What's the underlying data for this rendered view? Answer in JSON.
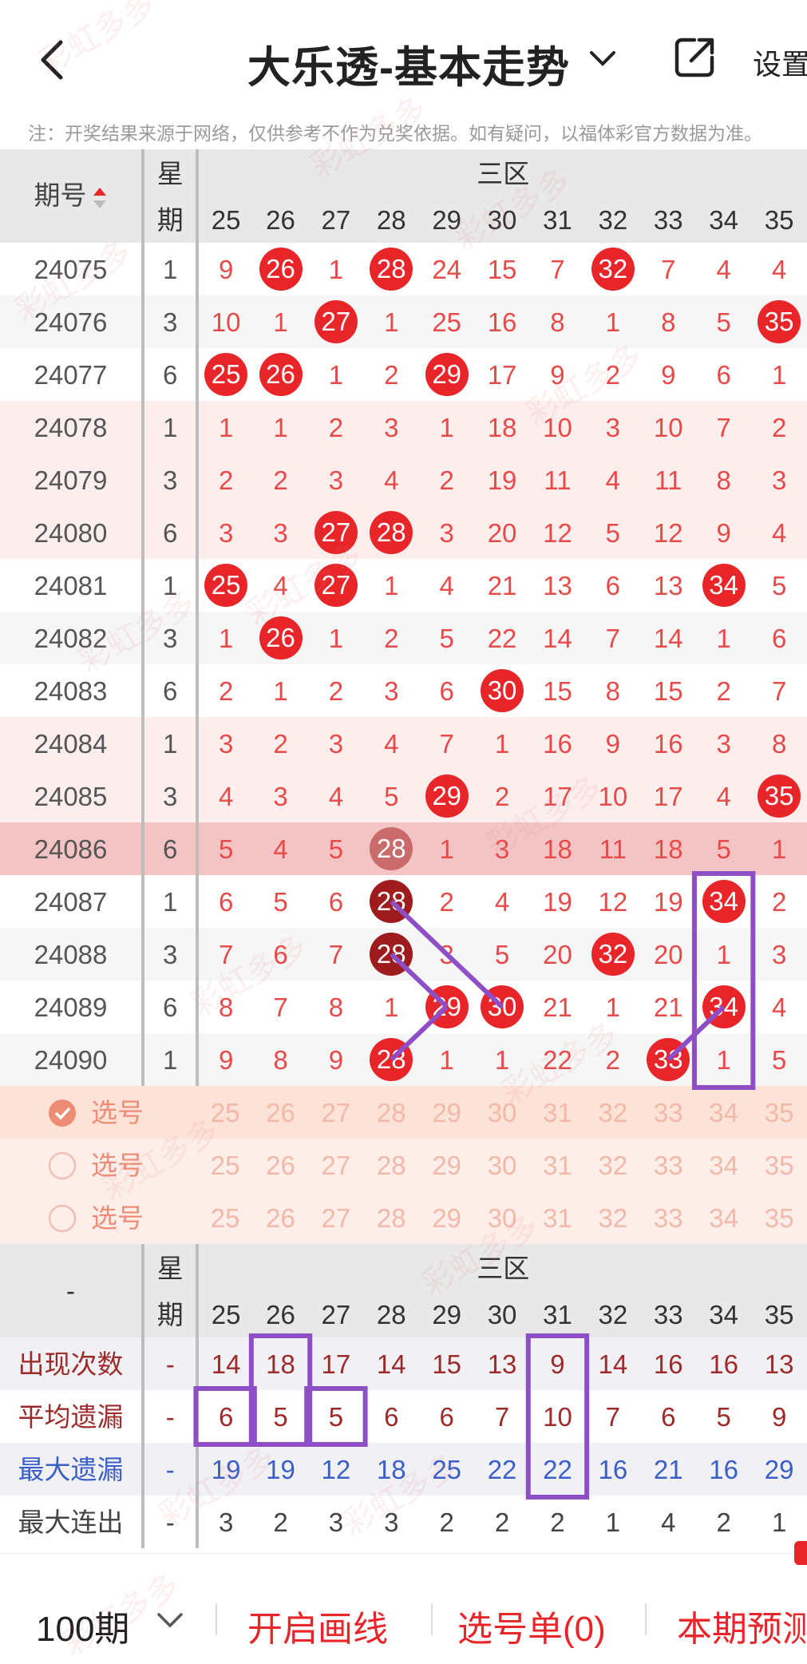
{
  "header": {
    "title": "大乐透-基本走势",
    "settings_label": "设置",
    "notice": "注：开奖结果来源于网络，仅供参考不作为兑奖依据。如有疑问，以福体彩官方数据为准。"
  },
  "table": {
    "issue_header": "期号",
    "week_header_1": "星",
    "week_header_2": "期",
    "zone_header": "三区",
    "numbers": [
      "25",
      "26",
      "27",
      "28",
      "29",
      "30",
      "31",
      "32",
      "33",
      "34",
      "35"
    ],
    "rows": [
      {
        "issue": "24075",
        "week": "1",
        "cells": [
          "9",
          "26",
          "1",
          "28",
          "24",
          "15",
          "7",
          "32",
          "7",
          "4",
          "4"
        ],
        "hits": [
          1,
          3,
          7
        ]
      },
      {
        "issue": "24076",
        "week": "3",
        "cells": [
          "10",
          "1",
          "27",
          "1",
          "25",
          "16",
          "8",
          "1",
          "8",
          "5",
          "35"
        ],
        "hits": [
          2,
          10
        ]
      },
      {
        "issue": "24077",
        "week": "6",
        "cells": [
          "25",
          "26",
          "1",
          "2",
          "29",
          "17",
          "9",
          "2",
          "9",
          "6",
          "1"
        ],
        "hits": [
          0,
          1,
          4
        ]
      },
      {
        "issue": "24078",
        "week": "1",
        "cells": [
          "1",
          "1",
          "2",
          "3",
          "1",
          "18",
          "10",
          "3",
          "10",
          "7",
          "2"
        ],
        "hits": []
      },
      {
        "issue": "24079",
        "week": "3",
        "cells": [
          "2",
          "2",
          "3",
          "4",
          "2",
          "19",
          "11",
          "4",
          "11",
          "8",
          "3"
        ],
        "hits": []
      },
      {
        "issue": "24080",
        "week": "6",
        "cells": [
          "3",
          "3",
          "27",
          "28",
          "3",
          "20",
          "12",
          "5",
          "12",
          "9",
          "4"
        ],
        "hits": [
          2,
          3
        ]
      },
      {
        "issue": "24081",
        "week": "1",
        "cells": [
          "25",
          "4",
          "27",
          "1",
          "4",
          "21",
          "13",
          "6",
          "13",
          "34",
          "5"
        ],
        "hits": [
          0,
          2,
          9
        ]
      },
      {
        "issue": "24082",
        "week": "3",
        "cells": [
          "1",
          "26",
          "1",
          "2",
          "5",
          "22",
          "14",
          "7",
          "14",
          "1",
          "6"
        ],
        "hits": [
          1
        ]
      },
      {
        "issue": "24083",
        "week": "6",
        "cells": [
          "2",
          "1",
          "2",
          "3",
          "6",
          "30",
          "15",
          "8",
          "15",
          "2",
          "7"
        ],
        "hits": [
          5
        ]
      },
      {
        "issue": "24084",
        "week": "1",
        "cells": [
          "3",
          "2",
          "3",
          "4",
          "7",
          "1",
          "16",
          "9",
          "16",
          "3",
          "8"
        ],
        "hits": []
      },
      {
        "issue": "24085",
        "week": "3",
        "cells": [
          "4",
          "3",
          "4",
          "5",
          "29",
          "2",
          "17",
          "10",
          "17",
          "4",
          "35"
        ],
        "hits": [
          4,
          10
        ]
      },
      {
        "issue": "24086",
        "week": "6",
        "cells": [
          "5",
          "4",
          "5",
          "28",
          "1",
          "3",
          "18",
          "11",
          "18",
          "5",
          "1"
        ],
        "hits": [
          3
        ]
      },
      {
        "issue": "24087",
        "week": "1",
        "cells": [
          "6",
          "5",
          "6",
          "28",
          "2",
          "4",
          "19",
          "12",
          "19",
          "34",
          "2"
        ],
        "hits": [
          3,
          9
        ]
      },
      {
        "issue": "24088",
        "week": "3",
        "cells": [
          "7",
          "6",
          "7",
          "28",
          "3",
          "5",
          "20",
          "32",
          "20",
          "1",
          "3"
        ],
        "hits": [
          3,
          7
        ]
      },
      {
        "issue": "24089",
        "week": "6",
        "cells": [
          "8",
          "7",
          "8",
          "1",
          "29",
          "30",
          "21",
          "1",
          "21",
          "34",
          "4"
        ],
        "hits": [
          4,
          5,
          9
        ]
      },
      {
        "issue": "24090",
        "week": "1",
        "cells": [
          "9",
          "8",
          "9",
          "28",
          "1",
          "1",
          "22",
          "2",
          "33",
          "1",
          "5"
        ],
        "hits": [
          3,
          8
        ]
      }
    ],
    "pick_rows": [
      {
        "label": "选号",
        "checked": true
      },
      {
        "label": "选号",
        "checked": false
      },
      {
        "label": "选号",
        "checked": false
      }
    ]
  },
  "stats": {
    "corner": "-",
    "week_header_1": "星",
    "week_header_2": "期",
    "zone_header": "三区",
    "rows": [
      {
        "label": "出现次数",
        "week": "-",
        "values": [
          "14",
          "18",
          "17",
          "14",
          "15",
          "13",
          "9",
          "14",
          "16",
          "16",
          "13"
        ],
        "color": "#9e2a2a"
      },
      {
        "label": "平均遗漏",
        "week": "-",
        "values": [
          "6",
          "5",
          "5",
          "6",
          "6",
          "7",
          "10",
          "7",
          "6",
          "5",
          "9"
        ],
        "color": "#9e2a2a"
      },
      {
        "label": "最大遗漏",
        "week": "-",
        "values": [
          "19",
          "19",
          "12",
          "18",
          "25",
          "22",
          "22",
          "16",
          "21",
          "16",
          "29"
        ],
        "color": "#3a5fc8"
      },
      {
        "label": "最大连出",
        "week": "-",
        "values": [
          "3",
          "2",
          "3",
          "3",
          "2",
          "2",
          "2",
          "1",
          "4",
          "2",
          "1"
        ],
        "color": "#444444"
      }
    ]
  },
  "footer": {
    "period": "100期",
    "draw_lines": "开启画线",
    "pick_list": "选号单(0)",
    "forecast": "本期预测"
  },
  "colors": {
    "ball_red": "#e8262a",
    "ball_dark": "#9e1b1e",
    "accent": "#e8262a",
    "annotation_purple": "#8e4ec6"
  },
  "watermark": "彩虹多多"
}
